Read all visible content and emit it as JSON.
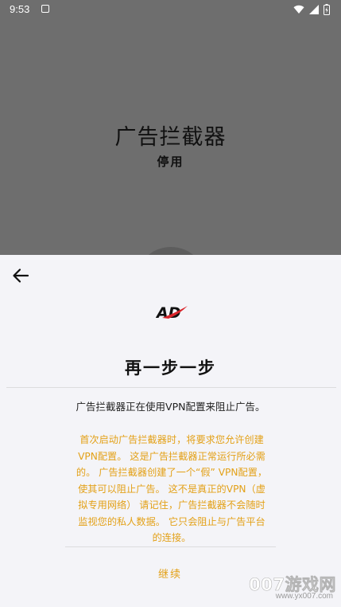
{
  "status_bar": {
    "time": "9:53",
    "icons": [
      "notification-icon",
      "wifi-icon",
      "signal-icon",
      "battery-icon"
    ]
  },
  "background_app": {
    "title": "广告拦截器",
    "status": "停用"
  },
  "sheet": {
    "back_icon": "arrow-left-icon",
    "logo_text": "AD",
    "title": "再一步一步",
    "main_text": "广告拦截器正在使用VPN配置来阻止广告。",
    "warning_lines": [
      "首次启动广告拦截器时，将要求您允许创建",
      "VPN配置。 这是广告拦截器正常运行所必需",
      "的。 广告拦截器创建了一个“假” VPN配置，",
      "使其可以阻止广告。 这不是真正的VPN（虚",
      "拟专用网络） 请记住，广告拦截器不会随时",
      "监视您的私人数据。 它只会阻止与广告平台",
      "的连接。"
    ],
    "continue_label": "继续"
  },
  "watermark": {
    "brand": "007游戏网",
    "url": "www.yx007.com"
  },
  "colors": {
    "overlay_gray": "#6e6e6e",
    "sheet_bg": "#f4f4f8",
    "accent_orange": "#e3a118",
    "logo_red": "#d9242a"
  }
}
